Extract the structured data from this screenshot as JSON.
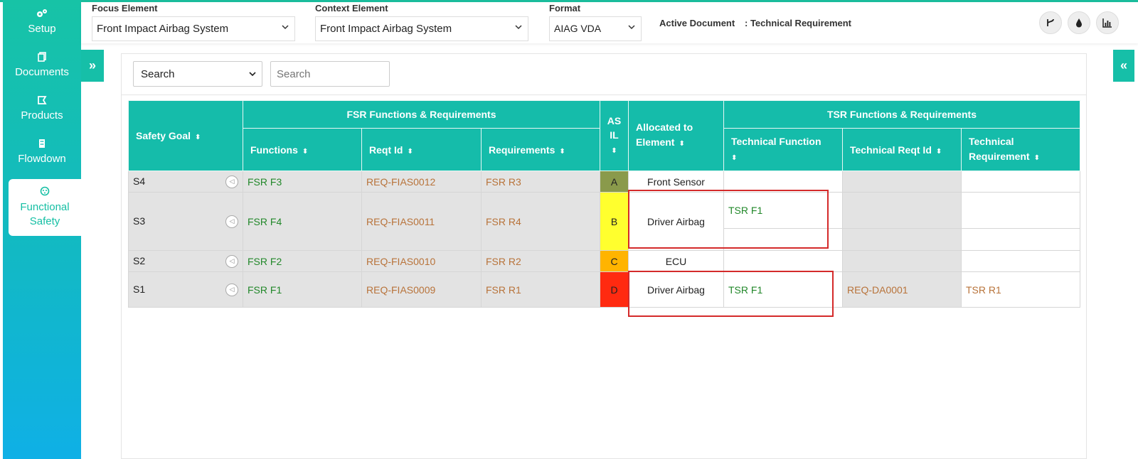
{
  "sidebar": {
    "items": [
      {
        "label": "Setup",
        "icon": "gears-icon"
      },
      {
        "label": "Documents",
        "icon": "documents-icon"
      },
      {
        "label": "Products",
        "icon": "products-icon"
      },
      {
        "label": "Flowdown",
        "icon": "flowdown-icon"
      },
      {
        "label": "Functional Safety",
        "icon": "functional-safety-icon"
      }
    ]
  },
  "header": {
    "focus_label": "Focus Element",
    "focus_value": "Front Impact Airbag System",
    "context_label": "Context Element",
    "context_value": "Front Impact Airbag System",
    "format_label": "Format",
    "format_value": "AIAG VDA",
    "active_doc_label": "Active Document",
    "active_doc_value": ": Technical Requirement"
  },
  "search": {
    "select_value": "Search",
    "input_placeholder": "Search"
  },
  "table": {
    "headers": {
      "safety_goal": "Safety Goal",
      "fsr_group": "FSR Functions & Requirements",
      "functions": "Functions",
      "reqt_id": "Reqt Id",
      "requirements": "Requirements",
      "asil": "AS IL",
      "allocated": "Allocated to Element",
      "tsr_group": "TSR Functions & Requirements",
      "tech_function": "Technical Function",
      "tech_reqt_id": "Technical Reqt Id",
      "tech_requirement": "Technical Requirement"
    },
    "rows": [
      {
        "goal": "S4",
        "function": "FSR F3",
        "reqt_id": "REQ-FIAS0012",
        "requirement": "FSR R3",
        "asil": "A",
        "element": "Front Sensor",
        "tech_function": "",
        "tech_reqt_id": "",
        "tech_requirement": ""
      },
      {
        "goal": "S3",
        "function": "FSR F4",
        "reqt_id": "REQ-FIAS0011",
        "requirement": "FSR R4",
        "asil": "B",
        "element": "Driver Airbag",
        "tech_function": "TSR F1",
        "tech_reqt_id": "",
        "tech_requirement": ""
      },
      {
        "goal": "S2",
        "function": "FSR F2",
        "reqt_id": "REQ-FIAS0010",
        "requirement": "FSR R2",
        "asil": "C",
        "element": "ECU",
        "tech_function": "",
        "tech_reqt_id": "",
        "tech_requirement": ""
      },
      {
        "goal": "S1",
        "function": "FSR F1",
        "reqt_id": "REQ-FIAS0009",
        "requirement": "FSR R1",
        "asil": "D",
        "element": "Driver Airbag",
        "tech_function": "TSR F1",
        "tech_reqt_id": "REQ-DA0001",
        "tech_requirement": "TSR R1"
      }
    ]
  },
  "colors": {
    "accent": "#15bcaa",
    "asil_a": "#8a9a4b",
    "asil_b": "#ffff2e",
    "asil_c": "#ffb400",
    "asil_d": "#ff2a10",
    "function_text": "#22882a",
    "reqt_text": "#b8733a"
  }
}
